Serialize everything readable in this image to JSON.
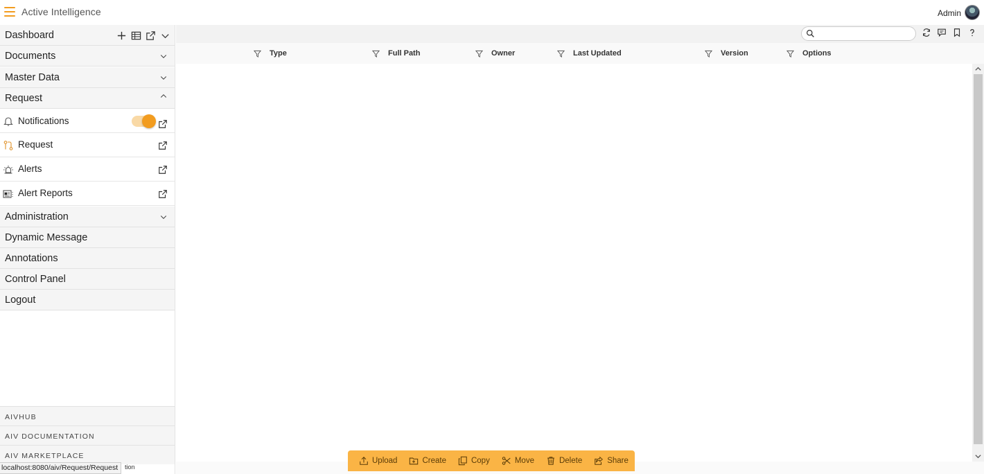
{
  "header": {
    "app_title": "Active Intelligence",
    "user_label": "Admin"
  },
  "sidebar": {
    "sections": {
      "dashboard": "Dashboard",
      "documents": "Documents",
      "master_data": "Master Data",
      "request": "Request",
      "administration": "Administration",
      "dynamic_message": "Dynamic Message",
      "annotations": "Annotations",
      "control_panel": "Control Panel",
      "logout": "Logout"
    },
    "request_items": {
      "notifications": "Notifications",
      "request": "Request",
      "alerts": "Alerts",
      "alert_reports": "Alert Reports"
    },
    "notifications_toggle_on": true,
    "footer_links": {
      "aivhub": "AIVHUB",
      "aiv_documentation": "AIV DOCUMENTATION",
      "aiv_marketplace": "AIV MARKETPLACE"
    }
  },
  "toolbar": {
    "search_value": "",
    "search_placeholder": ""
  },
  "table": {
    "columns": {
      "type": "Type",
      "full_path": "Full Path",
      "owner": "Owner",
      "last_updated": "Last Updated",
      "version": "Version",
      "options": "Options"
    },
    "rows": []
  },
  "actions": {
    "upload": "Upload",
    "create": "Create",
    "copy": "Copy",
    "move": "Move",
    "delete": "Delete",
    "share": "Share"
  },
  "status_bar": {
    "url": "localhost:8080/aiv/Request/Request",
    "overlap_text": "tion"
  },
  "colors": {
    "accent": "#f29c1f",
    "action_bar": "#fab445"
  }
}
